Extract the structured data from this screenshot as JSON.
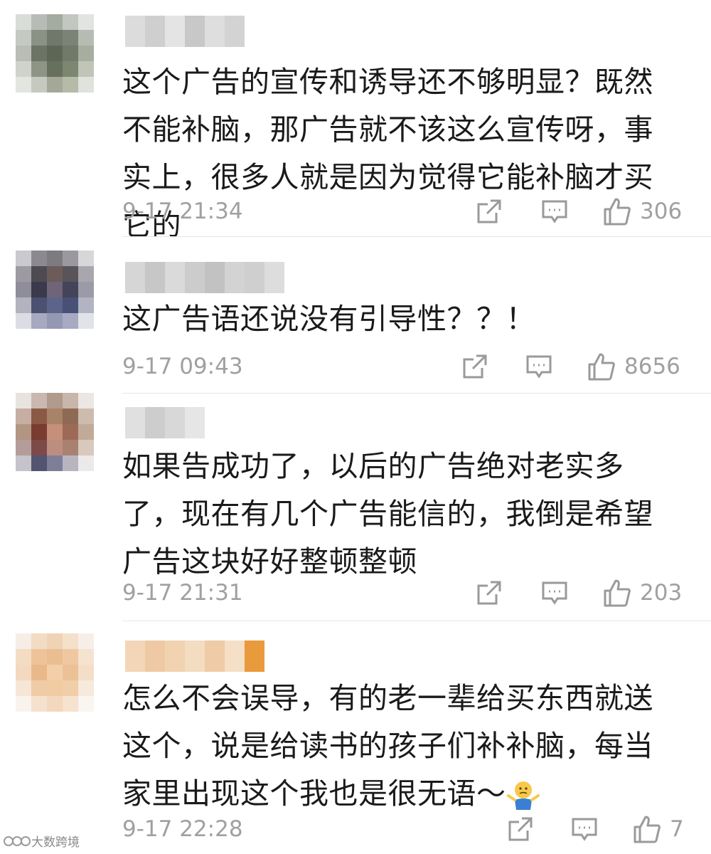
{
  "comments": [
    {
      "text": "这个广告的宣传和诱导还不够明显？既然不能补脑，那广告就不该这么宣传呀，事实上，很多人就是因为觉得它能补脑才买它的",
      "time": "9-17 21:34",
      "likes": "306"
    },
    {
      "text": "这广告语还说没有引导性？？！",
      "time": "9-17 09:43",
      "likes": "8656"
    },
    {
      "text": "如果告成功了，以后的广告绝对老实多了，现在有几个广告能信的，我倒是希望广告这块好好整顿整顿",
      "time": "9-17 21:31",
      "likes": "203"
    },
    {
      "text": "怎么不会误导，有的老一辈给买东西就送这个，说是给读书的孩子们补补脑，每当家里出现这个我也是很无语～",
      "time": "9-17 22:28",
      "likes": "7"
    }
  ],
  "icons": {
    "share": "share-icon",
    "reply": "comment-icon",
    "like": "thumbs-up-icon",
    "emoji": "shrug-emoji-icon"
  },
  "watermark": "大数跨境",
  "colors": {
    "meta": "#a0a0a0",
    "text": "#1a1a1a",
    "divider": "#e6e6e6"
  }
}
